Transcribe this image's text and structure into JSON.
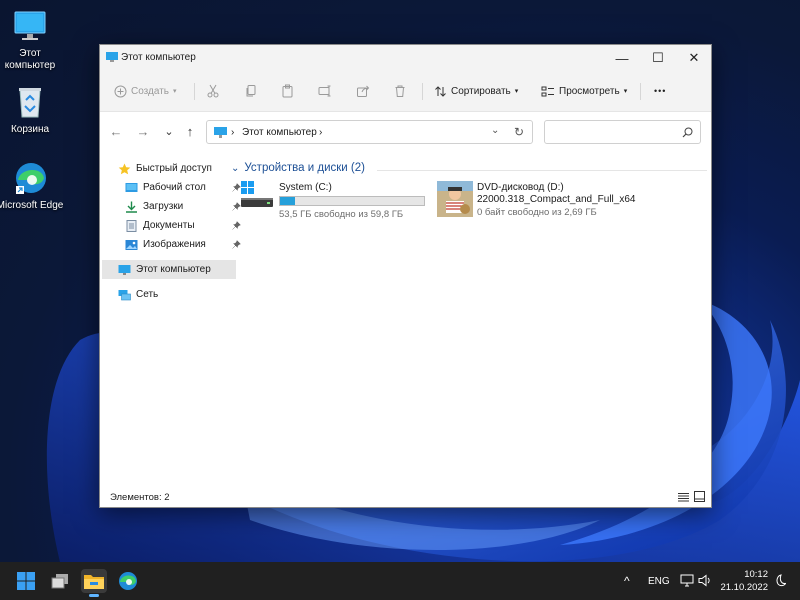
{
  "desktop": {
    "icons": [
      {
        "label": "Этот компьютер",
        "icon": "pc-icon"
      },
      {
        "label": "Корзина",
        "icon": "recycle-bin-icon"
      },
      {
        "label": "Microsoft Edge",
        "icon": "edge-icon"
      }
    ]
  },
  "window": {
    "title": "Этот компьютер",
    "controls": {
      "minimize": "—",
      "maximize": "☐",
      "close": "✕"
    }
  },
  "toolbar": {
    "create_label": "Создать",
    "sort_label": "Сортировать",
    "view_label": "Просмотреть",
    "more_label": "•••"
  },
  "address": {
    "breadcrumb": "Этот компьютер",
    "chevron": "›",
    "search_placeholder": ""
  },
  "nav": {
    "items": [
      {
        "label": "Быстрый доступ",
        "icon": "star-icon"
      },
      {
        "label": "Рабочий стол",
        "icon": "desktop-folder-icon",
        "pinned": true
      },
      {
        "label": "Загрузки",
        "icon": "download-icon",
        "pinned": true
      },
      {
        "label": "Документы",
        "icon": "documents-icon",
        "pinned": true
      },
      {
        "label": "Изображения",
        "icon": "pictures-icon",
        "pinned": true
      },
      {
        "label": "Этот компьютер",
        "icon": "pc-icon",
        "selected": true
      },
      {
        "label": "Сеть",
        "icon": "network-icon"
      }
    ]
  },
  "content": {
    "group_header": "Устройства и диски (2)",
    "drives": [
      {
        "name": "System (C:)",
        "free_text": "53,5 ГБ свободно из 59,8 ГБ",
        "used_fraction": 0.105,
        "icon": "windows-drive-icon"
      },
      {
        "name": "DVD-дисковод (D:)",
        "label2": "22000.318_Compact_and_Full_x64",
        "free_text": "0 байт свободно из 2,69 ГБ",
        "icon": "dvd-icon"
      }
    ]
  },
  "status": {
    "items_text": "Элементов: 2"
  },
  "taskbar": {
    "lang": "ENG",
    "time": "10:12",
    "date": "21.10.2022"
  },
  "colors": {
    "accent": "#26a0da",
    "group_header": "#1c4f95",
    "taskbar": "#202020"
  }
}
